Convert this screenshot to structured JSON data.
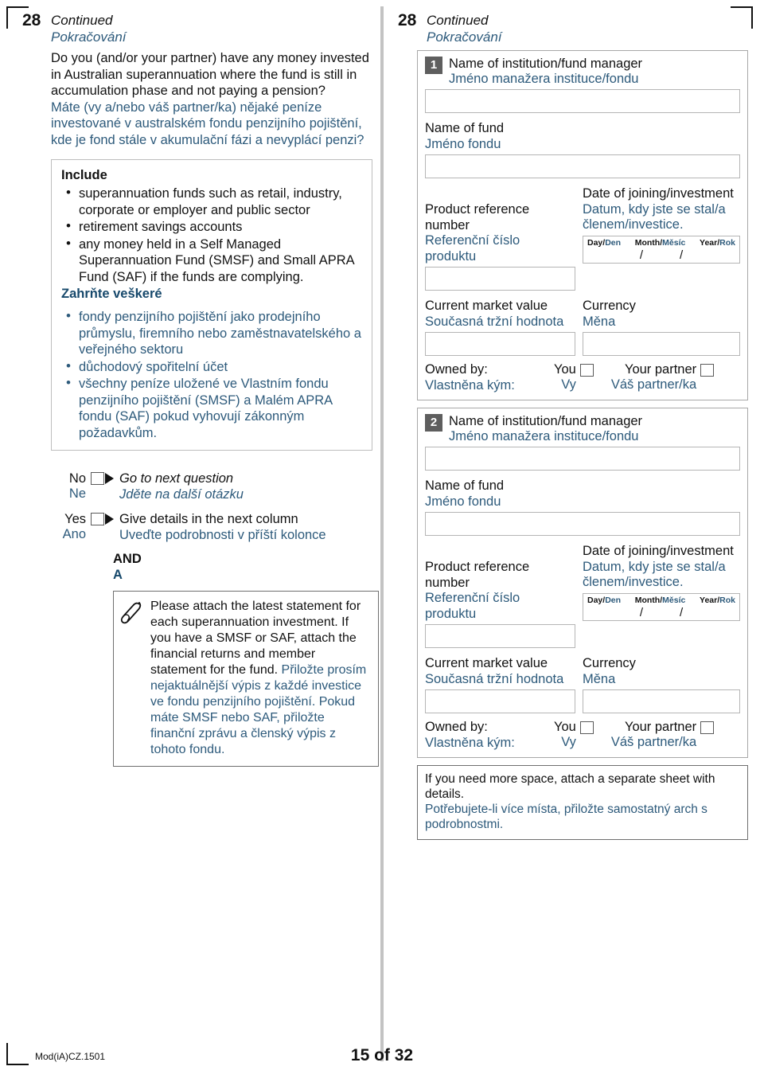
{
  "page": {
    "question_number": "28",
    "continued_en": "Continued",
    "continued_cz": "Pokračování",
    "mod_id": "Mod(iA)CZ.1501",
    "page_label": "15 of 32",
    "accent_blue": "#2d5a7b",
    "badge_gray": "#5e5e5e"
  },
  "left": {
    "question_en": "Do you (and/or your partner) have any money invested in Australian superannuation where the fund is still in accumulation phase and not paying a pension?",
    "question_cz": "Máte (vy a/nebo váš partner/ka) nějaké peníze investované v australském fondu penzijního pojištění, kde je fond stále v akumulační fázi a nevyplácí penzi?",
    "include": {
      "title_en": "Include",
      "bullets_en": [
        "superannuation funds such as retail, industry, corporate or employer and public sector",
        "retirement savings accounts",
        "any money held in a Self Managed Superannuation Fund (SMSF) and Small APRA Fund (SAF) if the funds are complying."
      ],
      "title_cz": "Zahrňte veškeré",
      "bullets_cz": [
        "fondy penzijního pojištění jako prodejního průmyslu, firemního nebo zaměstnavatelského a veřejného sektoru",
        "důchodový spořitelní účet",
        "všechny peníze uložené ve Vlastním fondu penzijního pojištění (SMSF) a Malém APRA fondu (SAF) pokud vyhovují zákonným požadavkům."
      ]
    },
    "answers": [
      {
        "label_en": "No",
        "label_cz": "Ne",
        "action_en": "Go to next question",
        "action_cz": "Jděte na další otázku",
        "italic": true
      },
      {
        "label_en": "Yes",
        "label_cz": "Ano",
        "action_en": "Give details in the next column",
        "action_cz": "Uveďte podrobnosti v příští kolonce",
        "italic": false
      }
    ],
    "and_en": "AND",
    "and_cz": "A",
    "attach_note": {
      "icon": "paperclip-icon",
      "text_en": "Please attach the latest statement for each superannuation investment. If you have a SMSF or SAF, attach the financial returns and member statement for the fund.",
      "text_cz": "Přiložte prosím nejaktuálnější výpis z každé investice ve fondu penzijního pojištění. Pokud máte SMSF nebo SAF, přiložte finanční zprávu a členský výpis z tohoto fondu."
    }
  },
  "right": {
    "entries": [
      {
        "number": "1",
        "institution_en": "Name of institution/fund manager",
        "institution_cz": "Jméno manažera instituce/fondu",
        "institution_value": "",
        "fund_en": "Name of fund",
        "fund_cz": "Jméno fondu",
        "fund_value": "",
        "product_ref_en": "Product reference number",
        "product_ref_cz": "Referenční číslo produktu",
        "product_ref_value": "",
        "date_en": "Date of joining/investment",
        "date_cz": "Datum, kdy jste se stal/a členem/investice.",
        "date_day_en": "Day/",
        "date_day_cz": "Den",
        "date_month_en": "Month/",
        "date_month_cz": "Měsíc",
        "date_year_en": "Year/",
        "date_year_cz": "Rok",
        "date_sep": "/",
        "date_day_value": "",
        "date_month_value": "",
        "date_year_value": "",
        "market_en": "Current market value",
        "market_cz": "Současná tržní hodnota",
        "market_value": "",
        "currency_en": "Currency",
        "currency_cz": "Měna",
        "currency_value": "",
        "owned_en": "Owned by:",
        "owned_cz": "Vlastněna kým:",
        "you_en": "You",
        "you_cz": "Vy",
        "partner_en": "Your partner",
        "partner_cz": "Váš partner/ka"
      },
      {
        "number": "2",
        "institution_en": "Name of institution/fund manager",
        "institution_cz": "Jméno manažera instituce/fondu",
        "institution_value": "",
        "fund_en": "Name of fund",
        "fund_cz": "Jméno fondu",
        "fund_value": "",
        "product_ref_en": "Product reference number",
        "product_ref_cz": "Referenční číslo produktu",
        "product_ref_value": "",
        "date_en": "Date of joining/investment",
        "date_cz": "Datum, kdy jste se stal/a členem/investice.",
        "date_day_en": "Day/",
        "date_day_cz": "Den",
        "date_month_en": "Month/",
        "date_month_cz": "Měsíc",
        "date_year_en": "Year/",
        "date_year_cz": "Rok",
        "date_sep": "/",
        "date_day_value": "",
        "date_month_value": "",
        "date_year_value": "",
        "market_en": "Current market value",
        "market_cz": "Současná tržní hodnota",
        "market_value": "",
        "currency_en": "Currency",
        "currency_cz": "Měna",
        "currency_value": "",
        "owned_en": "Owned by:",
        "owned_cz": "Vlastněna kým:",
        "you_en": "You",
        "you_cz": "Vy",
        "partner_en": "Your partner",
        "partner_cz": "Váš partner/ka"
      }
    ],
    "space_note_en": "If you need more space, attach a separate sheet with details.",
    "space_note_cz": "Potřebujete-li více místa, přiložte samostatný arch s podrobnostmi."
  }
}
